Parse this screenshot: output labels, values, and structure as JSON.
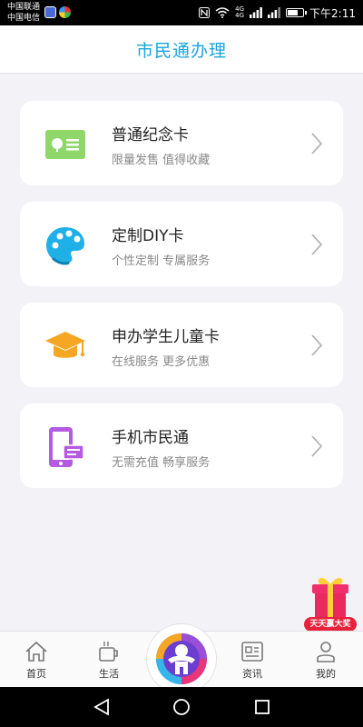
{
  "status_bar": {
    "carrier_1": "中国联通",
    "carrier_2": "中国电信",
    "network_1": "4G",
    "network_2": "4G",
    "time": "下午2:11"
  },
  "header": {
    "title": "市民通办理"
  },
  "cards": [
    {
      "title": "普通纪念卡",
      "subtitle": "限量发售 值得收藏",
      "icon": "commemorative-card-icon",
      "color": "#8fd76a"
    },
    {
      "title": "定制DIY卡",
      "subtitle": "个性定制 专属服务",
      "icon": "palette-icon",
      "color": "#1fb0e8"
    },
    {
      "title": "申办学生儿童卡",
      "subtitle": "在线服务 更多优惠",
      "icon": "graduation-cap-icon",
      "color": "#f5a623"
    },
    {
      "title": "手机市民通",
      "subtitle": "无需充值 畅享服务",
      "icon": "mobile-card-icon",
      "color": "#b45be0"
    }
  ],
  "promo": {
    "label": "天天赢大奖",
    "icon": "gift-box-icon",
    "color": "#e8223c"
  },
  "tabbar": {
    "tabs": [
      {
        "label": "首页",
        "icon": "home-icon"
      },
      {
        "label": "生活",
        "icon": "coffee-cup-icon"
      },
      {
        "label": "资讯",
        "icon": "news-icon"
      },
      {
        "label": "我的",
        "icon": "person-icon"
      }
    ],
    "center_icon": "app-logo-icon"
  },
  "colors": {
    "accent": "#19a4e0",
    "background": "#f3f3f7"
  }
}
